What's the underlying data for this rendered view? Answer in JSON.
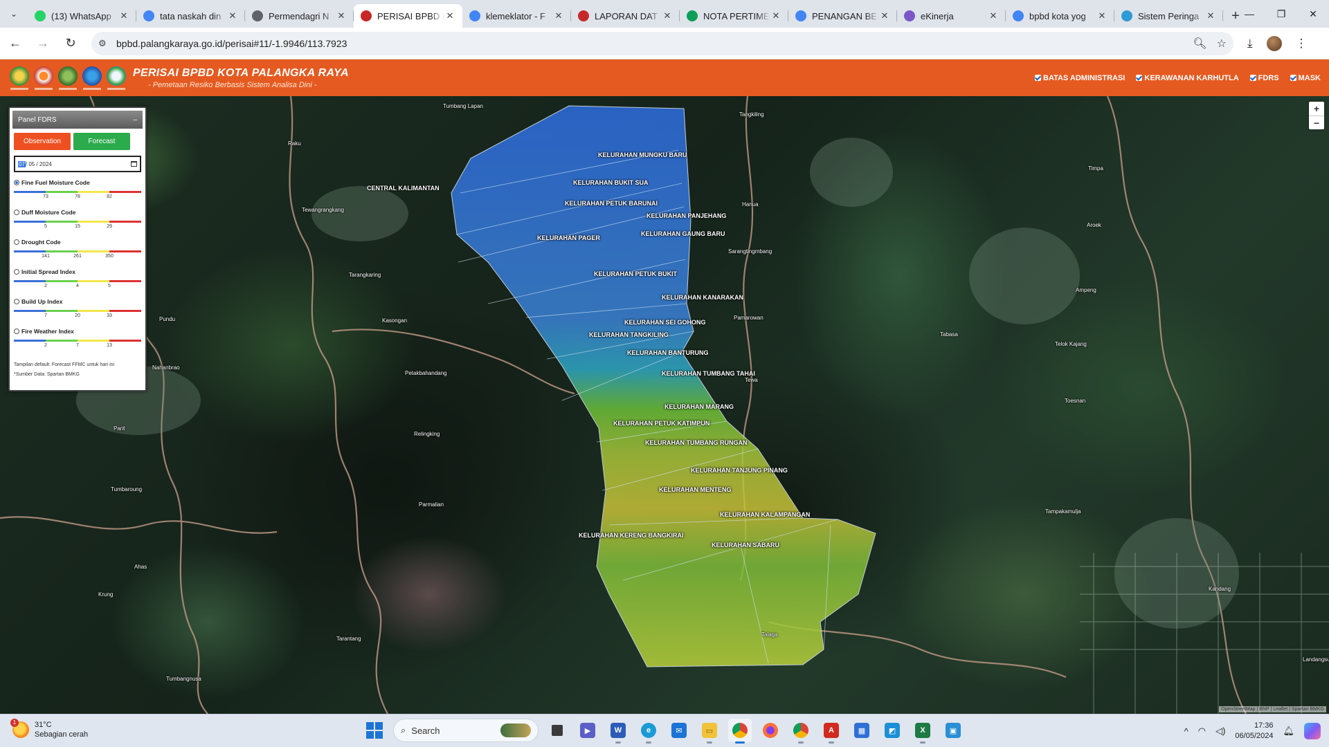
{
  "browser": {
    "tabs": [
      {
        "label": "(13) WhatsApp",
        "favicon": "whatsapp-icon",
        "color": "#25d366"
      },
      {
        "label": "tata naskah din",
        "favicon": "google-icon",
        "color": "#4285f4"
      },
      {
        "label": "Permendagri N",
        "favicon": "globe-icon",
        "color": "#5f6368"
      },
      {
        "label": "PERISAI BPBD K",
        "favicon": "bpbd-icon",
        "color": "#c62828",
        "active": true
      },
      {
        "label": "klemeklator - F",
        "favicon": "google-icon",
        "color": "#4285f4"
      },
      {
        "label": "LAPORAN DAT",
        "favicon": "bpbd-icon",
        "color": "#c62828"
      },
      {
        "label": "NOTA PERTIME",
        "favicon": "nota-icon",
        "color": "#0f9d58"
      },
      {
        "label": "PENANGAN BE",
        "favicon": "google-icon",
        "color": "#4285f4"
      },
      {
        "label": "eKinerja",
        "favicon": "ekinerja-icon",
        "color": "#7b57c8"
      },
      {
        "label": "bpbd kota yog",
        "favicon": "google-icon",
        "color": "#4285f4"
      },
      {
        "label": "Sistem Peringa",
        "favicon": "sistem-icon",
        "color": "#2e9bd6"
      }
    ],
    "url": "bpbd.palangkaraya.go.id/perisai#11/-1.9946/113.7923"
  },
  "site": {
    "title": "PERISAI BPBD KOTA PALANGKA RAYA",
    "subtitle": "- Pemetaan Resiko Berbasis Sistem Analisa Dini -",
    "layers": [
      "BATAS ADMINISTRASI",
      "KERAWANAN KARHUTLA",
      "FDRS",
      "MASK"
    ]
  },
  "panel": {
    "title": "Panel FDRS",
    "collapse": "–",
    "observation_label": "Observation",
    "forecast_label": "Forecast",
    "date_day": "07",
    "date_rest": "/ 05 / 2024",
    "indices": [
      {
        "label": "Fine Fuel Moisture Code",
        "ticks": [
          "73",
          "78",
          "82"
        ],
        "selected": true
      },
      {
        "label": "Duff Moisture Code",
        "ticks": [
          "5",
          "15",
          "29"
        ]
      },
      {
        "label": "Drought Code",
        "ticks": [
          "141",
          "261",
          "350"
        ]
      },
      {
        "label": "Initial Spread Index",
        "ticks": [
          "2",
          "4",
          "5"
        ]
      },
      {
        "label": "Build Up Index",
        "ticks": [
          "7",
          "20",
          "33"
        ]
      },
      {
        "label": "Fire Weather Index",
        "ticks": [
          "2",
          "7",
          "13"
        ]
      }
    ],
    "note1": "Tampilan default: Forecast FFMC untuk hari ini",
    "note2": "*Sumber Data: Spartan BMKG",
    "scale_colors": {
      "low": "#3b6fd8",
      "moderate": "#6ad04c",
      "high": "#f2e64a",
      "extreme": "#dc3232"
    }
  },
  "map": {
    "places": [
      "Tumbang Lapan",
      "Tangkiling",
      "Raku",
      "CENTRAL KALIMANTAN",
      "Tewangrangkang",
      "Timpa",
      "Hanua",
      "Aroek",
      "Sarangtingmbang",
      "Tarangkaring",
      "Ampeng",
      "Pundu",
      "Kasongan",
      "Pamarowan",
      "Tabasa",
      "Tewa",
      "Telok Kajang",
      "Nahanbrao",
      "Petakbahandang",
      "Parit",
      "Toesnan",
      "Relingking",
      "Parmalian",
      "Tumbaroung",
      "Tampakamulja",
      "Ahas",
      "Kandang",
      "Krung",
      "Talaga",
      "Tarantang",
      "Tumbangnusa",
      "Landangsuspo"
    ],
    "kelurahan": [
      "KELURAHAN MUNGKU BARU",
      "KELURAHAN BUKIT SUA",
      "KELURAHAN PETUK BARUNAI",
      "KELURAHAN PANJEHANG",
      "KELURAHAN GAUNG BARU",
      "KELURAHAN PAGER",
      "KELURAHAN PETUK BUKIT",
      "KELURAHAN KANARAKAN",
      "KELURAHAN SEI GOHONG",
      "KELURAHAN TANGKILING",
      "KELURAHAN BANTURUNG",
      "KELURAHAN TUMBANG TAHAI",
      "KELURAHAN MARANG",
      "KELURAHAN PETUK KATIMPUN",
      "KELURAHAN TUMBANG RUNGAN",
      "KELURAHAN TANJUNG PINANG",
      "KELURAHAN MENTENG",
      "KELURAHAN KALAMPANGAN",
      "KELURAHAN KERENG BANGKIRAI",
      "KELURAHAN SABARU"
    ],
    "zoom_in": "+",
    "zoom_out": "−",
    "attribution": "OpenStreetMap | BNP | Leaflet | Spartan BMKG"
  },
  "taskbar": {
    "temp": "31°C",
    "condition": "Sebagian cerah",
    "badge": "1",
    "search_label": "Search",
    "time": "17:36",
    "date": "06/05/2024"
  }
}
